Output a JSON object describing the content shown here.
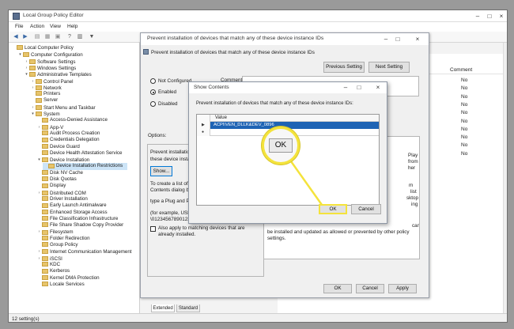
{
  "window": {
    "title": "Local Group Policy Editor"
  },
  "menu": [
    "File",
    "Action",
    "View",
    "Help"
  ],
  "tree": {
    "items": [
      {
        "label": "Local Computer Policy",
        "level": 0,
        "arrow": ""
      },
      {
        "label": "Computer Configuration",
        "level": 1,
        "arrow": "▾"
      },
      {
        "label": "Software Settings",
        "level": 2,
        "arrow": "›"
      },
      {
        "label": "Windows Settings",
        "level": 2,
        "arrow": "›"
      },
      {
        "label": "Administrative Templates",
        "level": 2,
        "arrow": "▾"
      },
      {
        "label": "Control Panel",
        "level": 3,
        "arrow": "›"
      },
      {
        "label": "Network",
        "level": 3,
        "arrow": "›"
      },
      {
        "label": "Printers",
        "level": 3,
        "arrow": ""
      },
      {
        "label": "Server",
        "level": 3,
        "arrow": ""
      },
      {
        "label": "Start Menu and Taskbar",
        "level": 3,
        "arrow": "›"
      },
      {
        "label": "System",
        "level": 3,
        "arrow": "▾"
      },
      {
        "label": "Access-Denied Assistance",
        "level": 4,
        "arrow": ""
      },
      {
        "label": "App-V",
        "level": 4,
        "arrow": "›"
      },
      {
        "label": "Audit Process Creation",
        "level": 4,
        "arrow": ""
      },
      {
        "label": "Credentials Delegation",
        "level": 4,
        "arrow": ""
      },
      {
        "label": "Device Guard",
        "level": 4,
        "arrow": ""
      },
      {
        "label": "Device Health Attestation Service",
        "level": 4,
        "arrow": ""
      },
      {
        "label": "Device Installation",
        "level": 4,
        "arrow": "▾"
      },
      {
        "label": "Device Installation Restrictions",
        "level": 5,
        "arrow": "",
        "selected": true
      },
      {
        "label": "Disk NV Cache",
        "level": 4,
        "arrow": ""
      },
      {
        "label": "Disk Quotas",
        "level": 4,
        "arrow": ""
      },
      {
        "label": "Display",
        "level": 4,
        "arrow": ""
      },
      {
        "label": "Distributed COM",
        "level": 4,
        "arrow": "›"
      },
      {
        "label": "Driver Installation",
        "level": 4,
        "arrow": ""
      },
      {
        "label": "Early Launch Antimalware",
        "level": 4,
        "arrow": ""
      },
      {
        "label": "Enhanced Storage Access",
        "level": 4,
        "arrow": ""
      },
      {
        "label": "File Classification Infrastructure",
        "level": 4,
        "arrow": ""
      },
      {
        "label": "File Share Shadow Copy Provider",
        "level": 4,
        "arrow": ""
      },
      {
        "label": "Filesystem",
        "level": 4,
        "arrow": "›"
      },
      {
        "label": "Folder Redirection",
        "level": 4,
        "arrow": ""
      },
      {
        "label": "Group Policy",
        "level": 4,
        "arrow": ""
      },
      {
        "label": "Internet Communication Management",
        "level": 4,
        "arrow": "›"
      },
      {
        "label": "iSCSI",
        "level": 4,
        "arrow": "›"
      },
      {
        "label": "KDC",
        "level": 4,
        "arrow": ""
      },
      {
        "label": "Kerberos",
        "level": 4,
        "arrow": ""
      },
      {
        "label": "Kernel DMA Protection",
        "level": 4,
        "arrow": ""
      },
      {
        "label": "Locale Services",
        "level": 4,
        "arrow": ""
      }
    ]
  },
  "right_pane": {
    "column_header": "Comment",
    "values": [
      "No",
      "No",
      "No",
      "No",
      "No",
      "No",
      "No",
      "No",
      "No",
      "No"
    ],
    "text_fragments": [
      "Play",
      "from",
      "her",
      "m",
      "list",
      "sktop",
      "ing",
      "can",
      "be installed and updated as allowed or prevented by other policy",
      "settings."
    ]
  },
  "tabs": [
    "Extended",
    "Standard"
  ],
  "status": "12 setting(s)",
  "policy_dialog": {
    "title": "Prevent installation of devices that match any of these device instance IDs",
    "heading": "Prevent installation of devices that match any of these device instance IDs",
    "prev_button": "Previous Setting",
    "next_button": "Next Setting",
    "comment_label": "Comment:",
    "radio_not_configured": "Not Configured",
    "radio_enabled": "Enabled",
    "radio_disabled": "Disabled",
    "options_label": "Options:",
    "options_lines": [
      "Prevent installation of",
      "these device instance"
    ],
    "show_button": "Show...",
    "help_lines": [
      "To create a list of devic",
      "Contents dialog box, i",
      "type a Plug and Play d",
      "(for example, USB\\VID",
      "\\0123456789012345"
    ],
    "also_apply": "Also apply to matching devices that are already installed.",
    "ok": "OK",
    "cancel": "Cancel",
    "apply": "Apply"
  },
  "show_dialog": {
    "title": "Show Contents",
    "description": "Prevent installation of devices that match any of these device instance IDs:",
    "column": "Value",
    "rows": [
      "ACPI\\VEN_DLLK&DEV_0896",
      ""
    ],
    "ok": "OK",
    "cancel": "Cancel"
  },
  "callout": {
    "label": "OK",
    "color": "#f4e33c"
  }
}
